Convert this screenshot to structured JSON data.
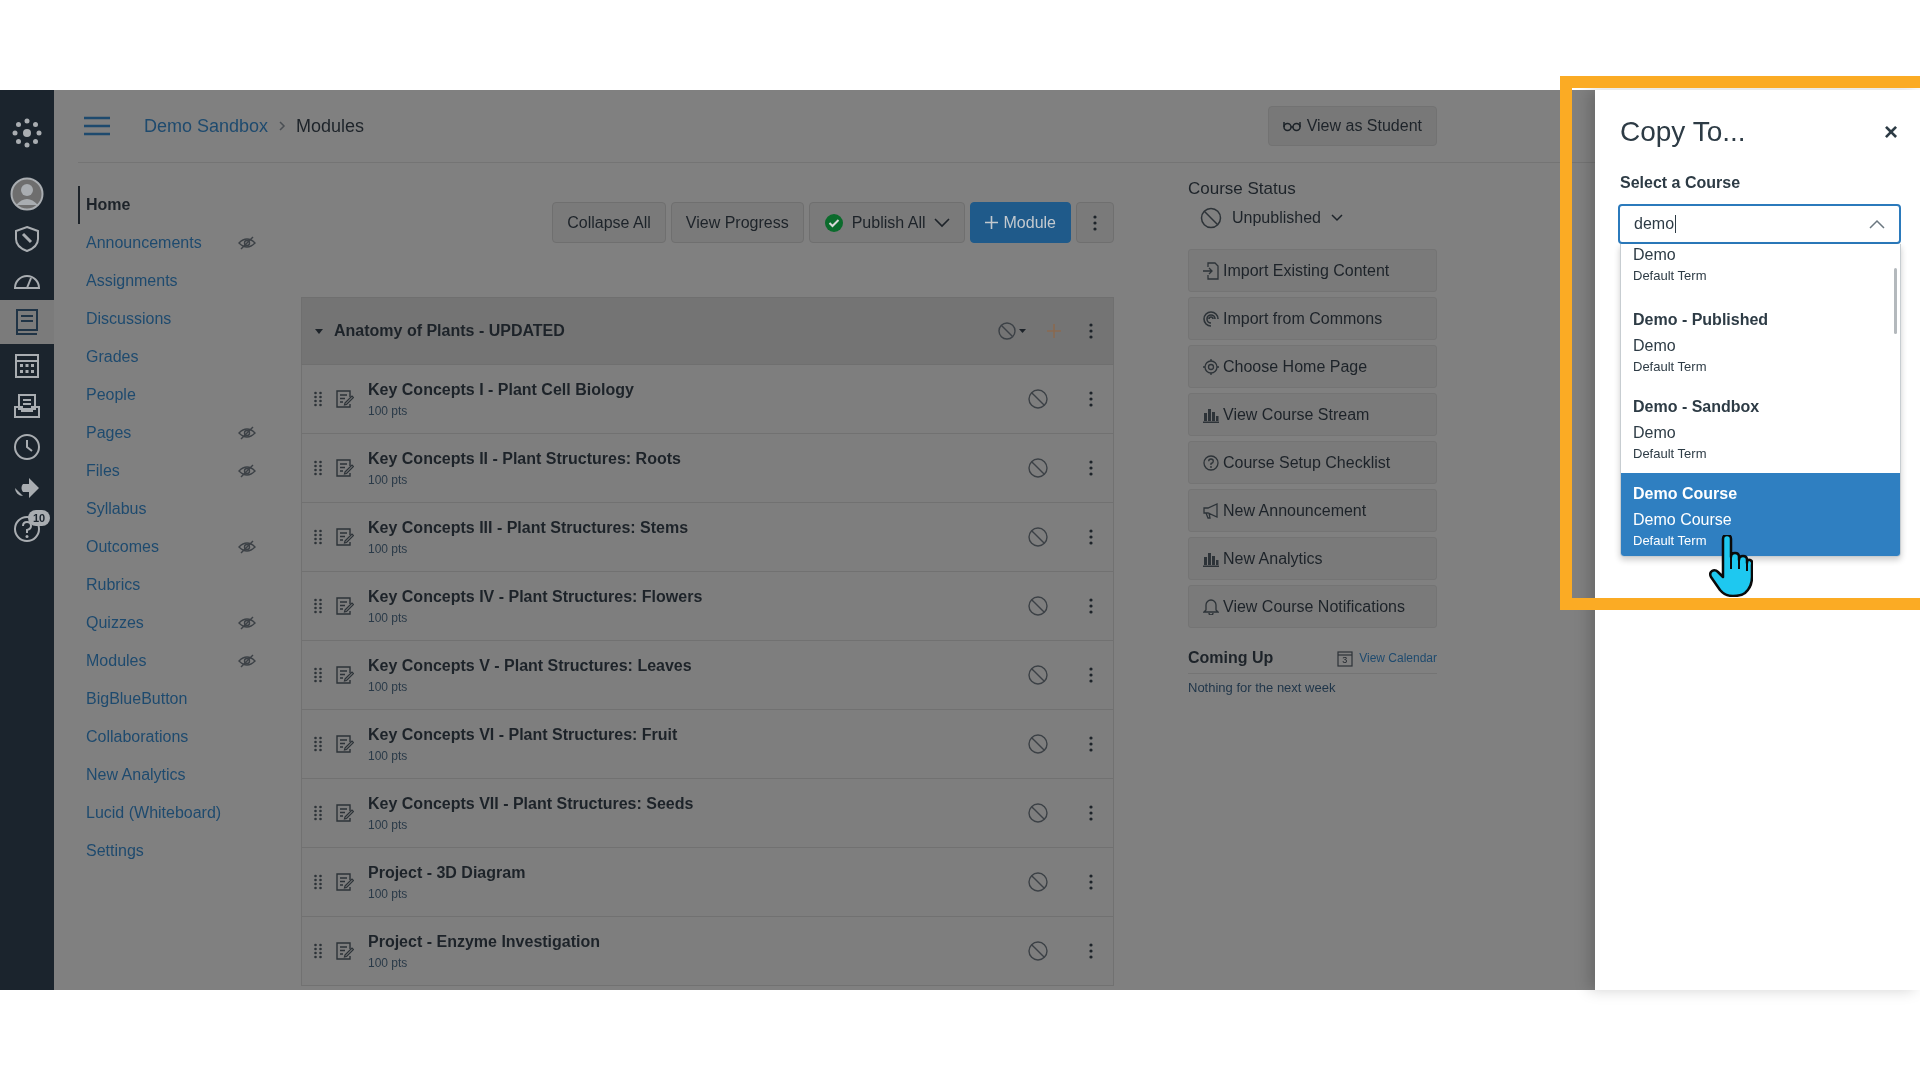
{
  "global_nav": {
    "items": [
      {
        "kind": "logo",
        "selected": false
      },
      {
        "kind": "account",
        "selected": false
      },
      {
        "kind": "admin",
        "selected": false
      },
      {
        "kind": "dashboard",
        "selected": false
      },
      {
        "kind": "courses",
        "selected": true
      },
      {
        "kind": "calendar",
        "selected": false
      },
      {
        "kind": "inbox",
        "selected": false
      },
      {
        "kind": "history",
        "selected": false
      },
      {
        "kind": "commons",
        "selected": false
      },
      {
        "kind": "help",
        "selected": false,
        "badge": "10"
      }
    ]
  },
  "breadcrumb": [
    "Demo Sandbox",
    "Modules"
  ],
  "view_as_student": "View as Student",
  "course_nav": {
    "items": [
      {
        "label": "Home",
        "selected": true,
        "hidden": false
      },
      {
        "label": "Announcements",
        "selected": false,
        "hidden": true
      },
      {
        "label": "Assignments",
        "selected": false,
        "hidden": false
      },
      {
        "label": "Discussions",
        "selected": false,
        "hidden": false
      },
      {
        "label": "Grades",
        "selected": false,
        "hidden": false
      },
      {
        "label": "People",
        "selected": false,
        "hidden": false
      },
      {
        "label": "Pages",
        "selected": false,
        "hidden": true
      },
      {
        "label": "Files",
        "selected": false,
        "hidden": true
      },
      {
        "label": "Syllabus",
        "selected": false,
        "hidden": false
      },
      {
        "label": "Outcomes",
        "selected": false,
        "hidden": true
      },
      {
        "label": "Rubrics",
        "selected": false,
        "hidden": false
      },
      {
        "label": "Quizzes",
        "selected": false,
        "hidden": true
      },
      {
        "label": "Modules",
        "selected": false,
        "hidden": true
      },
      {
        "label": "BigBlueButton",
        "selected": false,
        "hidden": false
      },
      {
        "label": "Collaborations",
        "selected": false,
        "hidden": false
      },
      {
        "label": "New Analytics",
        "selected": false,
        "hidden": false
      },
      {
        "label": "Lucid (Whiteboard)",
        "selected": false,
        "hidden": false
      },
      {
        "label": "Settings",
        "selected": false,
        "hidden": false
      }
    ]
  },
  "toolbar": {
    "collapse_all": "Collapse All",
    "view_progress": "View Progress",
    "publish_all": "Publish All",
    "add_module": "Module"
  },
  "module": {
    "title": "Anatomy of Plants - UPDATED",
    "expanded": true,
    "published": false,
    "items": [
      {
        "title": "Key Concepts I - Plant Cell Biology",
        "points": "100 pts",
        "published": false
      },
      {
        "title": "Key Concepts II - Plant Structures: Roots",
        "points": "100 pts",
        "published": false
      },
      {
        "title": "Key Concepts III - Plant Structures: Stems",
        "points": "100 pts",
        "published": false
      },
      {
        "title": "Key Concepts IV - Plant Structures: Flowers",
        "points": "100 pts",
        "published": false
      },
      {
        "title": "Key Concepts V - Plant Structures: Leaves",
        "points": "100 pts",
        "published": false
      },
      {
        "title": "Key Concepts VI - Plant Structures: Fruit",
        "points": "100 pts",
        "published": false
      },
      {
        "title": "Key Concepts VII - Plant Structures: Seeds",
        "points": "100 pts",
        "published": false
      },
      {
        "title": "Project - 3D Diagram",
        "points": "100 pts",
        "published": false
      },
      {
        "title": "Project - Enzyme Investigation",
        "points": "100 pts",
        "published": false
      }
    ]
  },
  "course_status": {
    "heading": "Course Status",
    "status": "Unpublished",
    "actions": [
      {
        "kind": "import",
        "label": "Import Existing Content"
      },
      {
        "kind": "commons",
        "label": "Import from Commons"
      },
      {
        "kind": "home",
        "label": "Choose Home Page"
      },
      {
        "kind": "stream",
        "label": "View Course Stream"
      },
      {
        "kind": "checklist",
        "label": "Course Setup Checklist"
      },
      {
        "kind": "announcement",
        "label": "New Announcement"
      },
      {
        "kind": "analytics",
        "label": "New Analytics"
      },
      {
        "kind": "notifications",
        "label": "View Course Notifications"
      }
    ]
  },
  "coming_up": {
    "heading": "Coming Up",
    "view_calendar": "View Calendar",
    "calendar_day": "3",
    "empty_text": "Nothing for the next week"
  },
  "dialog": {
    "title": "Copy To...",
    "close": "×",
    "field_label": "Select a Course",
    "search_value": "demo",
    "options": [
      {
        "account": "Demo",
        "term": "Default Term",
        "selected": false
      },
      {
        "name": "Demo - Published",
        "account": "Demo",
        "term": "Default Term",
        "selected": false
      },
      {
        "name": "Demo - Sandbox",
        "account": "Demo",
        "term": "Default Term",
        "selected": false
      },
      {
        "name": "Demo Course",
        "account": "Demo Course",
        "term": "Default Term",
        "selected": true
      }
    ]
  }
}
